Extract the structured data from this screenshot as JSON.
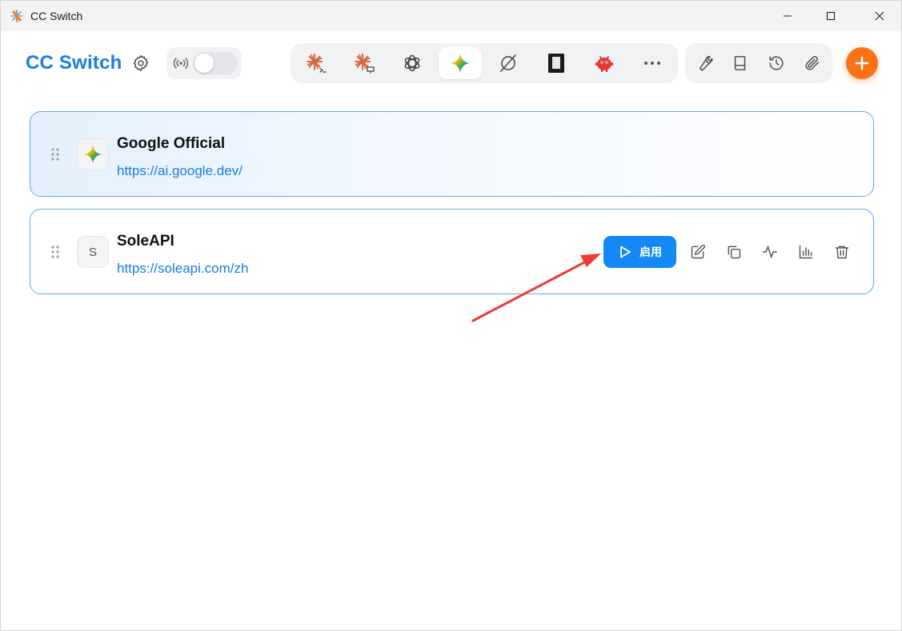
{
  "window": {
    "title": "CC Switch",
    "controls": [
      "minimize-icon",
      "maximize-icon",
      "close-icon"
    ]
  },
  "header": {
    "app_title": "CC Switch",
    "proxy_toggle_on": false,
    "app_tabs": [
      {
        "icon": "claude-code-icon",
        "active": false
      },
      {
        "icon": "claude-desktop-icon",
        "active": false
      },
      {
        "icon": "openai-codex-icon",
        "active": false
      },
      {
        "icon": "gemini-icon",
        "active": true
      },
      {
        "icon": "opencode-icon",
        "active": false
      },
      {
        "icon": "terminal-app-icon",
        "active": false
      },
      {
        "icon": "red-bot-icon",
        "active": false
      },
      {
        "icon": "more-icon",
        "active": false
      }
    ],
    "tools": [
      "wrench-icon",
      "book-icon",
      "history-icon",
      "paperclip-icon"
    ],
    "add_icon": "plus-icon"
  },
  "providers": [
    {
      "name": "Google Official",
      "url": "https://ai.google.dev/",
      "logo": "gemini-icon",
      "active": true
    },
    {
      "name": "SoleAPI",
      "url": "https://soleapi.com/zh",
      "logo_letter": "S",
      "active": false,
      "enable_label": "启用"
    }
  ],
  "colors": {
    "accent": "#1a7ce0",
    "enable_button": "#1488f4",
    "add_button": "#f97316",
    "card_border": "#62a8ea",
    "annotation_arrow": "#ef3b36"
  }
}
